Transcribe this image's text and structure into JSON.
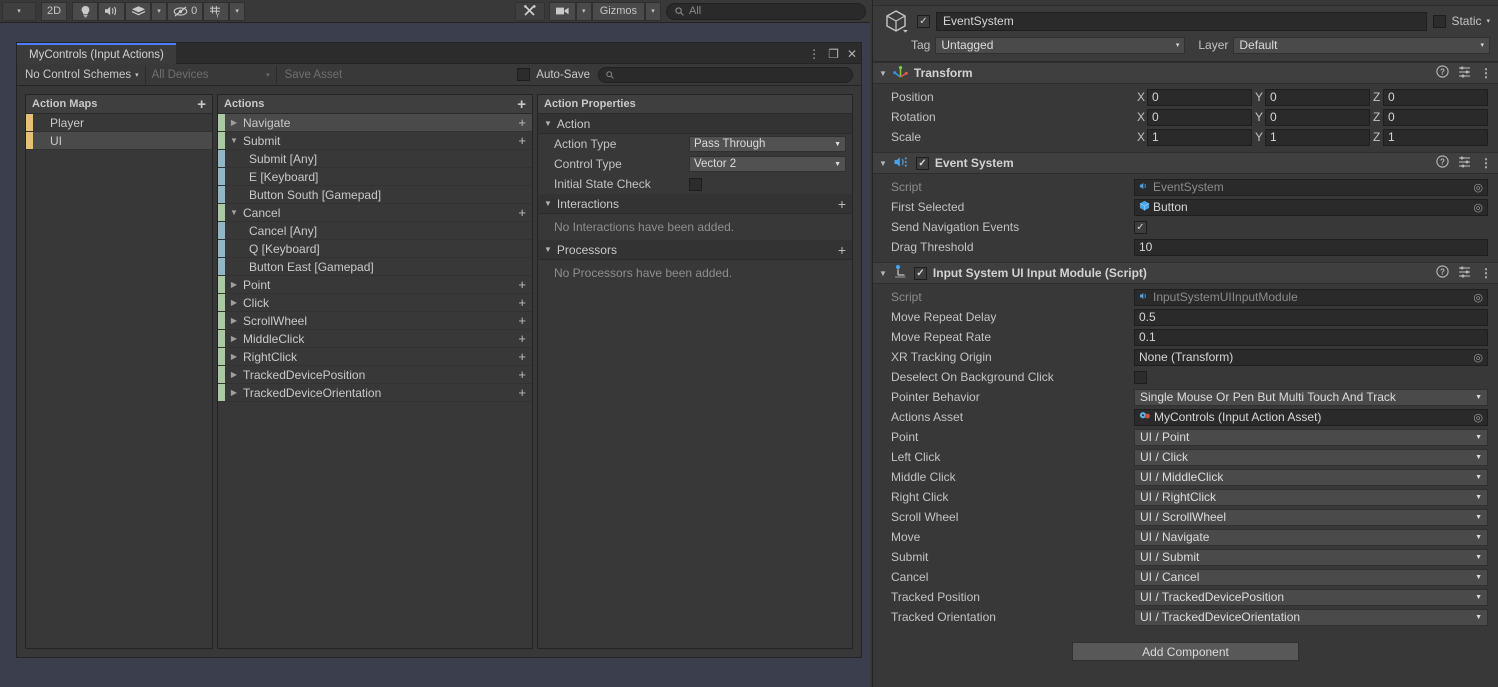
{
  "scene_toolbar": {
    "left_arrow": "▾",
    "mode_2d": "2D",
    "light_icon": "lighting-icon",
    "audio_icon": "audio-icon",
    "fx_icon": "effects-icon",
    "fx_caret": "▾",
    "hidden_count": "0",
    "grid_icon": "grid-snap-icon",
    "grid_caret": "▾",
    "tools_icon": "tools-icon",
    "camera_icon": "camera-icon",
    "camera_caret": "▾",
    "gizmos_label": "Gizmos",
    "gizmos_caret": "▾",
    "search_placeholder": "All",
    "search_value": ""
  },
  "input_actions_window": {
    "tab_title": "MyControls (Input Actions)",
    "window_menu_icon": "⋮",
    "window_maximize_icon": "❐",
    "window_close_icon": "✕",
    "toolbar": {
      "control_schemes": "No Control Schemes",
      "control_schemes_caret": "▾",
      "devices": "All Devices",
      "devices_caret": "▾",
      "save_asset": "Save Asset",
      "autosave_label": "Auto-Save",
      "autosave_checked": false,
      "search_placeholder": "",
      "search_value": ""
    },
    "action_maps": {
      "header": "Action Maps",
      "add_label": "+",
      "items": [
        {
          "label": "Player",
          "selected": false
        },
        {
          "label": "UI",
          "selected": true
        }
      ]
    },
    "actions": {
      "header": "Actions",
      "add_label": "+",
      "rows": [
        {
          "label": "Navigate",
          "kind": "action",
          "expanded": false,
          "selected": true,
          "triangle": "▶",
          "plus": "+"
        },
        {
          "label": "Submit",
          "kind": "action",
          "expanded": true,
          "selected": false,
          "triangle": "▼",
          "plus": "+"
        },
        {
          "label": "Submit [Any]",
          "kind": "binding",
          "selected": false
        },
        {
          "label": "E [Keyboard]",
          "kind": "binding",
          "selected": false
        },
        {
          "label": "Button South [Gamepad]",
          "kind": "binding",
          "selected": false
        },
        {
          "label": "Cancel",
          "kind": "action",
          "expanded": true,
          "selected": false,
          "triangle": "▼",
          "plus": "+"
        },
        {
          "label": "Cancel [Any]",
          "kind": "binding",
          "selected": false
        },
        {
          "label": "Q [Keyboard]",
          "kind": "binding",
          "selected": false
        },
        {
          "label": "Button East [Gamepad]",
          "kind": "binding",
          "selected": false
        },
        {
          "label": "Point",
          "kind": "action",
          "expanded": false,
          "selected": false,
          "triangle": "▶",
          "plus": "+"
        },
        {
          "label": "Click",
          "kind": "action",
          "expanded": false,
          "selected": false,
          "triangle": "▶",
          "plus": "+"
        },
        {
          "label": "ScrollWheel",
          "kind": "action",
          "expanded": false,
          "selected": false,
          "triangle": "▶",
          "plus": "+"
        },
        {
          "label": "MiddleClick",
          "kind": "action",
          "expanded": false,
          "selected": false,
          "triangle": "▶",
          "plus": "+"
        },
        {
          "label": "RightClick",
          "kind": "action",
          "expanded": false,
          "selected": false,
          "triangle": "▶",
          "plus": "+"
        },
        {
          "label": "TrackedDevicePosition",
          "kind": "action",
          "expanded": false,
          "selected": false,
          "triangle": "▶",
          "plus": "+"
        },
        {
          "label": "TrackedDeviceOrientation",
          "kind": "action",
          "expanded": false,
          "selected": false,
          "triangle": "▶",
          "plus": "+"
        }
      ]
    },
    "action_properties": {
      "header": "Action Properties",
      "sections": [
        {
          "title": "Action",
          "triangle": "▼",
          "has_add": false,
          "rows": [
            {
              "label": "Action Type",
              "type": "dropdown",
              "value": "Pass Through"
            },
            {
              "label": "Control Type",
              "type": "dropdown",
              "value": "Vector 2"
            },
            {
              "label": "Initial State Check",
              "type": "checkbox",
              "checked": false
            }
          ]
        },
        {
          "title": "Interactions",
          "triangle": "▼",
          "has_add": true,
          "add_label": "+",
          "empty_text": "No Interactions have been added."
        },
        {
          "title": "Processors",
          "triangle": "▼",
          "has_add": true,
          "add_label": "+",
          "empty_text": "No Processors have been added."
        }
      ]
    }
  },
  "inspector": {
    "game_object": {
      "icon": "gameobject-cube-icon",
      "enabled": true,
      "name": "EventSystem",
      "static_label": "Static",
      "static_checked": false,
      "static_caret": "▾",
      "tag_label": "Tag",
      "tag_value": "Untagged",
      "layer_label": "Layer",
      "layer_value": "Default",
      "caret": "▾"
    },
    "components": [
      {
        "name": "Transform",
        "icon": "transform-icon",
        "triangle": "▼",
        "has_enable_toggle": false,
        "help_icon": "?",
        "preset_icon": "preset-icon",
        "menu_icon": "⋮",
        "rows": [
          {
            "label": "Position",
            "type": "vector3",
            "axes": [
              "X",
              "Y",
              "Z"
            ],
            "values": [
              "0",
              "0",
              "0"
            ]
          },
          {
            "label": "Rotation",
            "type": "vector3",
            "axes": [
              "X",
              "Y",
              "Z"
            ],
            "values": [
              "0",
              "0",
              "0"
            ]
          },
          {
            "label": "Scale",
            "type": "vector3",
            "axes": [
              "X",
              "Y",
              "Z"
            ],
            "values": [
              "1",
              "1",
              "1"
            ]
          }
        ]
      },
      {
        "name": "Event System",
        "icon": "eventsystem-icon",
        "triangle": "▼",
        "has_enable_toggle": true,
        "enabled": true,
        "help_icon": "?",
        "preset_icon": "preset-icon",
        "menu_icon": "⋮",
        "rows": [
          {
            "label": "Script",
            "type": "object",
            "value": "EventSystem",
            "dim": true,
            "obj_icon": "script-icon"
          },
          {
            "label": "First Selected",
            "type": "object",
            "value": "Button",
            "dim": false,
            "obj_icon": "gameobject-icon"
          },
          {
            "label": "Send Navigation Events",
            "type": "checkbox",
            "checked": true
          },
          {
            "label": "Drag Threshold",
            "type": "text",
            "value": "10"
          }
        ]
      },
      {
        "name": "Input System UI Input Module (Script)",
        "icon": "inputmodule-icon",
        "triangle": "▼",
        "has_enable_toggle": true,
        "enabled": true,
        "help_icon": "?",
        "preset_icon": "preset-icon",
        "menu_icon": "⋮",
        "rows": [
          {
            "label": "Script",
            "type": "object",
            "value": "InputSystemUIInputModule",
            "dim": true,
            "obj_icon": "script-icon"
          },
          {
            "label": "Move Repeat Delay",
            "type": "text",
            "value": "0.5"
          },
          {
            "label": "Move Repeat Rate",
            "type": "text",
            "value": "0.1"
          },
          {
            "label": "XR Tracking Origin",
            "type": "object",
            "value": "None (Transform)",
            "dim": false,
            "obj_icon": ""
          },
          {
            "label": "Deselect On Background Click",
            "type": "checkbox",
            "checked": false
          },
          {
            "label": "Pointer Behavior",
            "type": "dropdown",
            "value": "Single Mouse Or Pen But Multi Touch And Track"
          },
          {
            "label": "Actions Asset",
            "type": "object",
            "value": "MyControls (Input Action Asset)",
            "dim": false,
            "obj_icon": "asset-icon"
          },
          {
            "label": "Point",
            "type": "dropdown",
            "value": "UI / Point"
          },
          {
            "label": "Left Click",
            "type": "dropdown",
            "value": "UI / Click"
          },
          {
            "label": "Middle Click",
            "type": "dropdown",
            "value": "UI / MiddleClick"
          },
          {
            "label": "Right Click",
            "type": "dropdown",
            "value": "UI / RightClick"
          },
          {
            "label": "Scroll Wheel",
            "type": "dropdown",
            "value": "UI / ScrollWheel"
          },
          {
            "label": "Move",
            "type": "dropdown",
            "value": "UI / Navigate"
          },
          {
            "label": "Submit",
            "type": "dropdown",
            "value": "UI / Submit"
          },
          {
            "label": "Cancel",
            "type": "dropdown",
            "value": "UI / Cancel"
          },
          {
            "label": "Tracked Position",
            "type": "dropdown",
            "value": "UI / TrackedDevicePosition"
          },
          {
            "label": "Tracked Orientation",
            "type": "dropdown",
            "value": "UI / TrackedDeviceOrientation"
          }
        ]
      }
    ],
    "add_component_label": "Add Component"
  },
  "colors": {
    "background": "#383838",
    "panel": "#3f3f3f",
    "field": "#2a2a2a",
    "dropdown": "#4a4a4a",
    "accent_tab": "#4c7eff",
    "accent_map": "#e8c170",
    "accent_action": "#a9c9a1",
    "accent_binding": "#8fb7c6",
    "object_link": "#59a5e0"
  }
}
